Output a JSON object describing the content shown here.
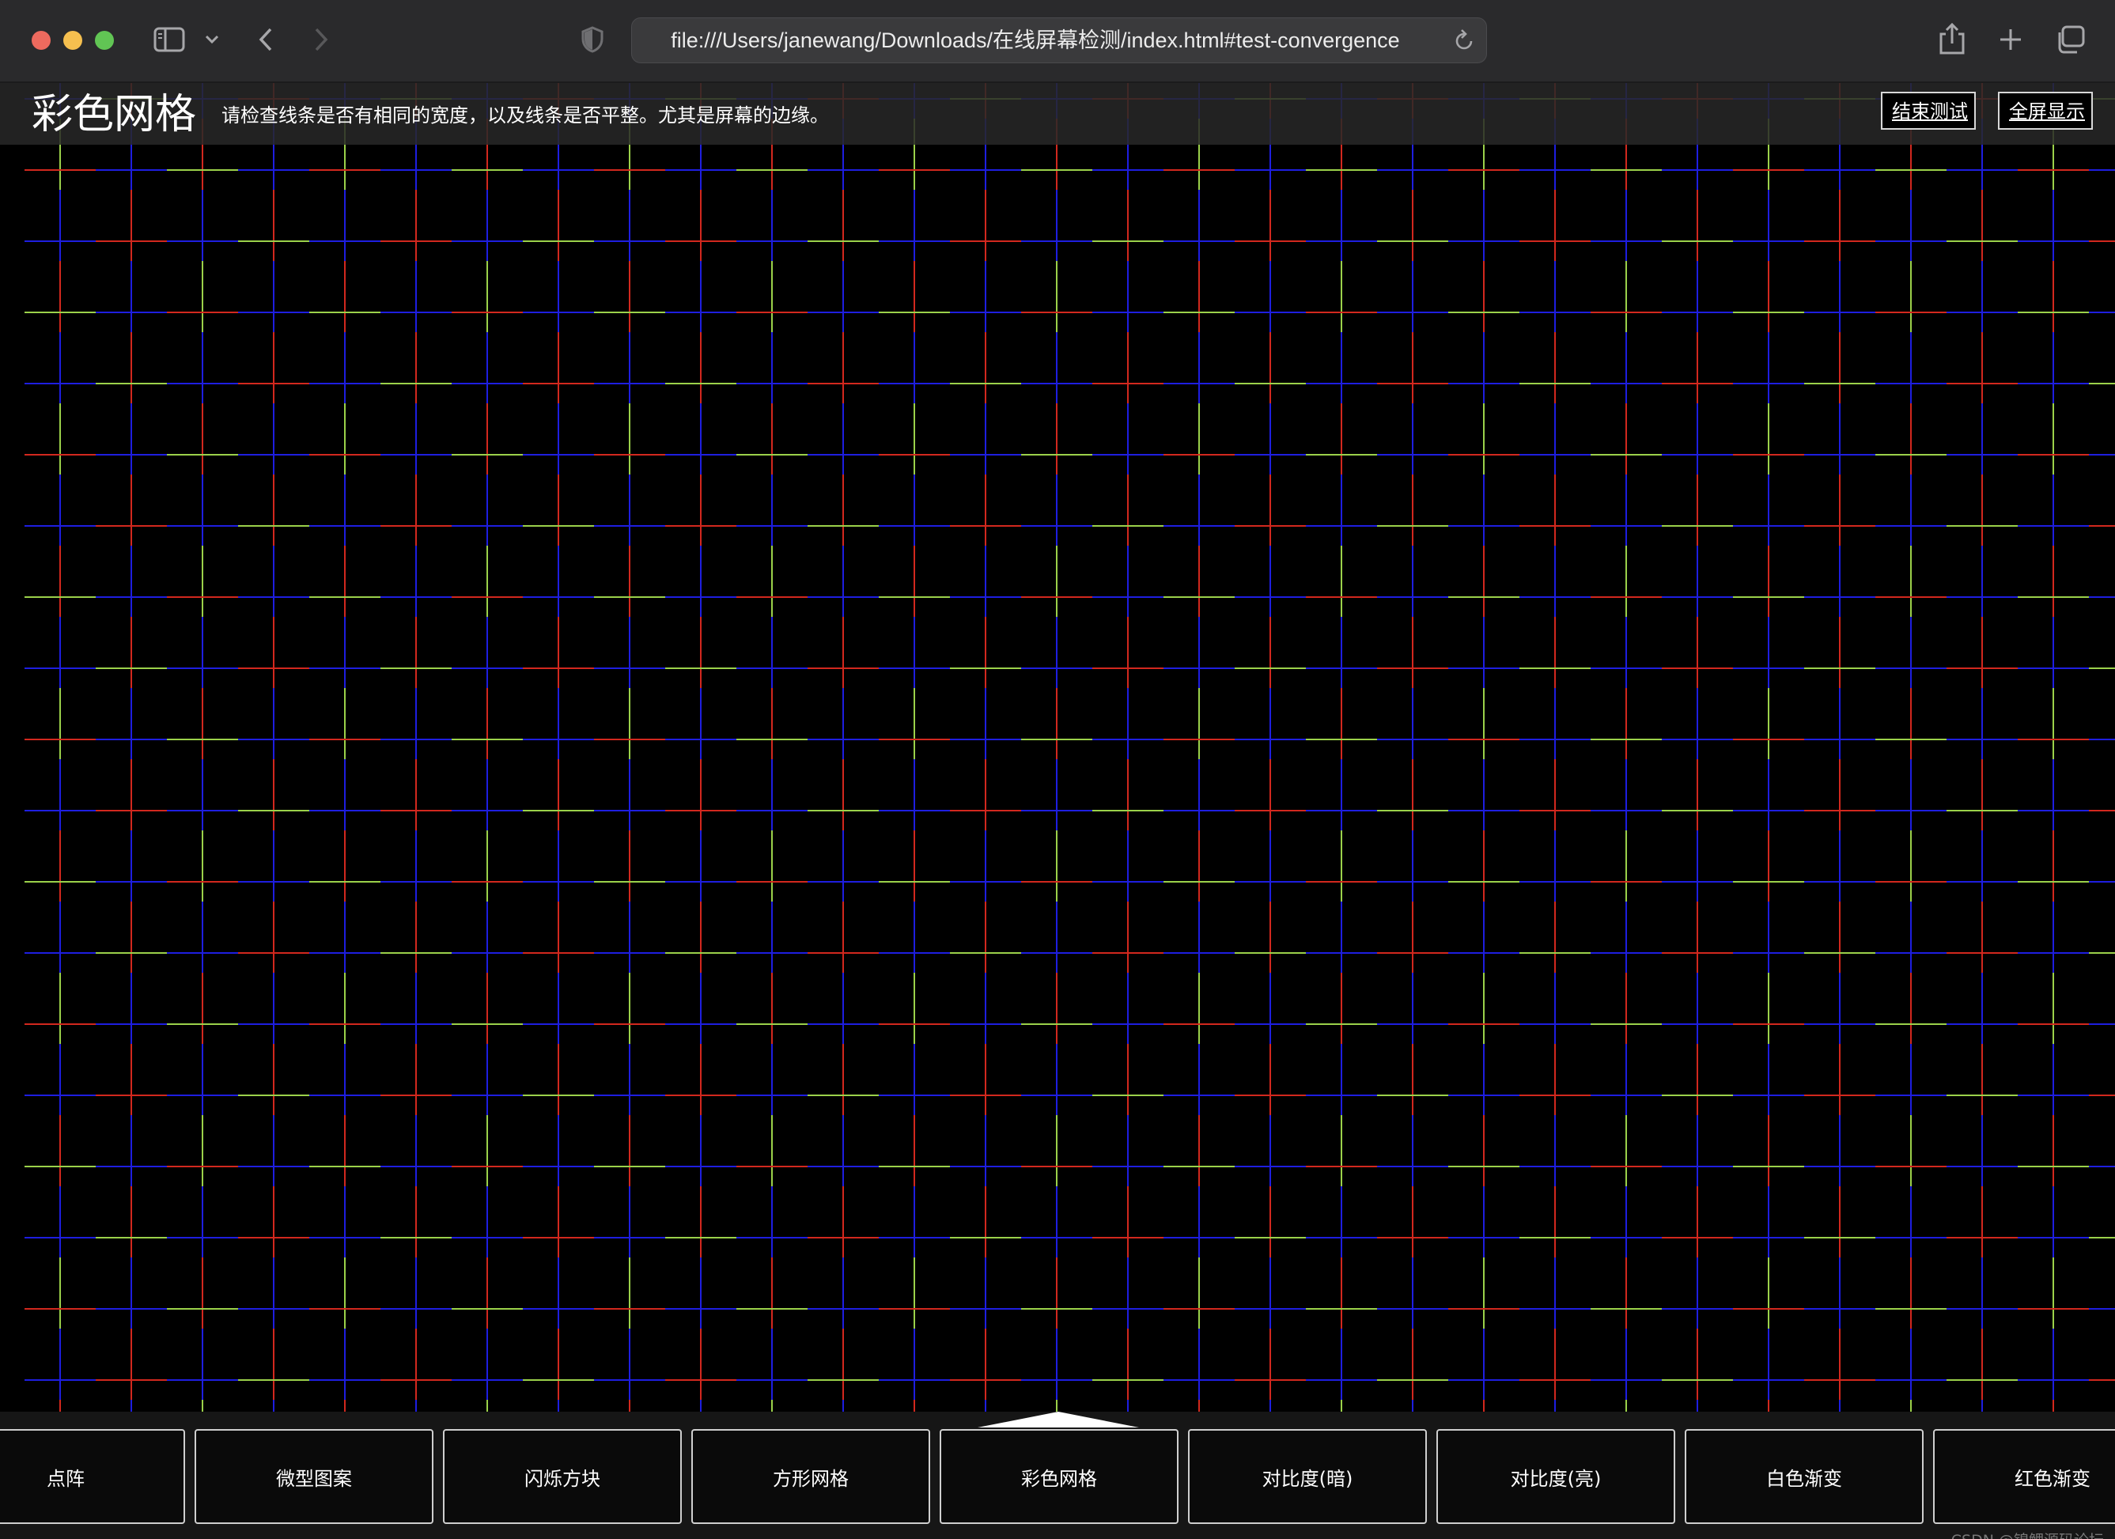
{
  "browser": {
    "url": "file:///Users/janewang/Downloads/在线屏幕检测/index.html#test-convergence"
  },
  "header": {
    "title": "彩色网格",
    "description": "请检查线条是否有相同的宽度，以及线条是否平整。尤其是屏幕的边缘。",
    "end_button": "结束测试",
    "fullscreen_button": "全屏显示"
  },
  "menu": {
    "items": [
      "点阵",
      "微型图案",
      "闪烁方块",
      "方形网格",
      "彩色网格",
      "对比度(暗)",
      "对比度(亮)",
      "白色渐变",
      "红色渐变"
    ],
    "selected": "彩色网格"
  },
  "grid_colors": {
    "background": "#000000",
    "green": "#9bd14a",
    "blue": "#1e1ee0",
    "red": "#d2281e"
  },
  "watermark": "CSDN @锦鲤源码论坛"
}
